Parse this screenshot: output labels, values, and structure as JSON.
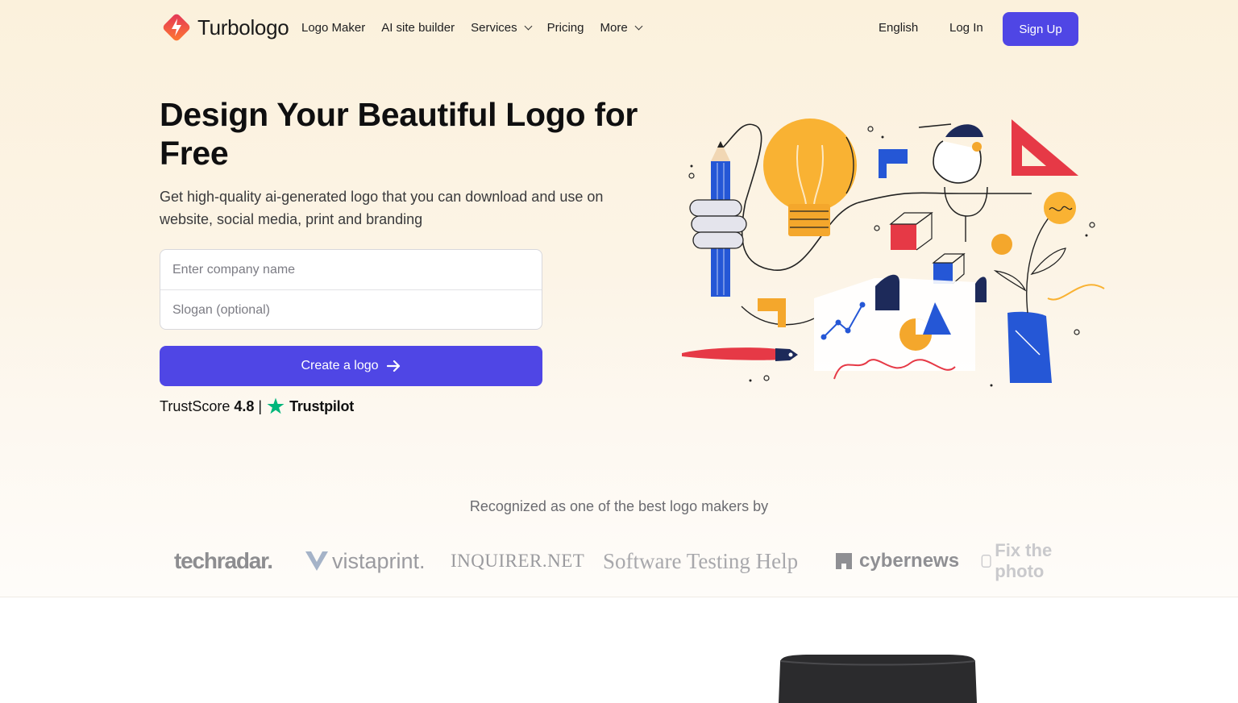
{
  "header": {
    "brand": "Turbologo",
    "nav": [
      {
        "label": "Logo Maker",
        "dropdown": false
      },
      {
        "label": "AI site builder",
        "dropdown": false
      },
      {
        "label": "Services",
        "dropdown": true
      },
      {
        "label": "Pricing",
        "dropdown": false
      },
      {
        "label": "More",
        "dropdown": true
      }
    ],
    "language": "English",
    "login": "Log In",
    "signup": "Sign Up"
  },
  "hero": {
    "title": "Design Your Beautiful Logo for Free",
    "subtitle": "Get high-quality ai-generated logo that you can download and use on website, social media, print and branding",
    "company_placeholder": "Enter company name",
    "slogan_placeholder": "Slogan (optional)",
    "cta": "Create a logo",
    "trust_label": "TrustScore",
    "trust_score": "4.8",
    "trust_sep": "|",
    "trustpilot": "Trustpilot"
  },
  "recognized": {
    "heading": "Recognized as one of the best logo makers by",
    "brands": [
      "techradar.",
      "vistaprint.",
      "INQUIRER.NET",
      "Software Testing Help",
      "cybernews",
      "Fix the photo"
    ]
  },
  "colors": {
    "accent": "#4f46e5",
    "trustpilot_green": "#00b67a",
    "hero_bg": "#fbf1dc"
  }
}
